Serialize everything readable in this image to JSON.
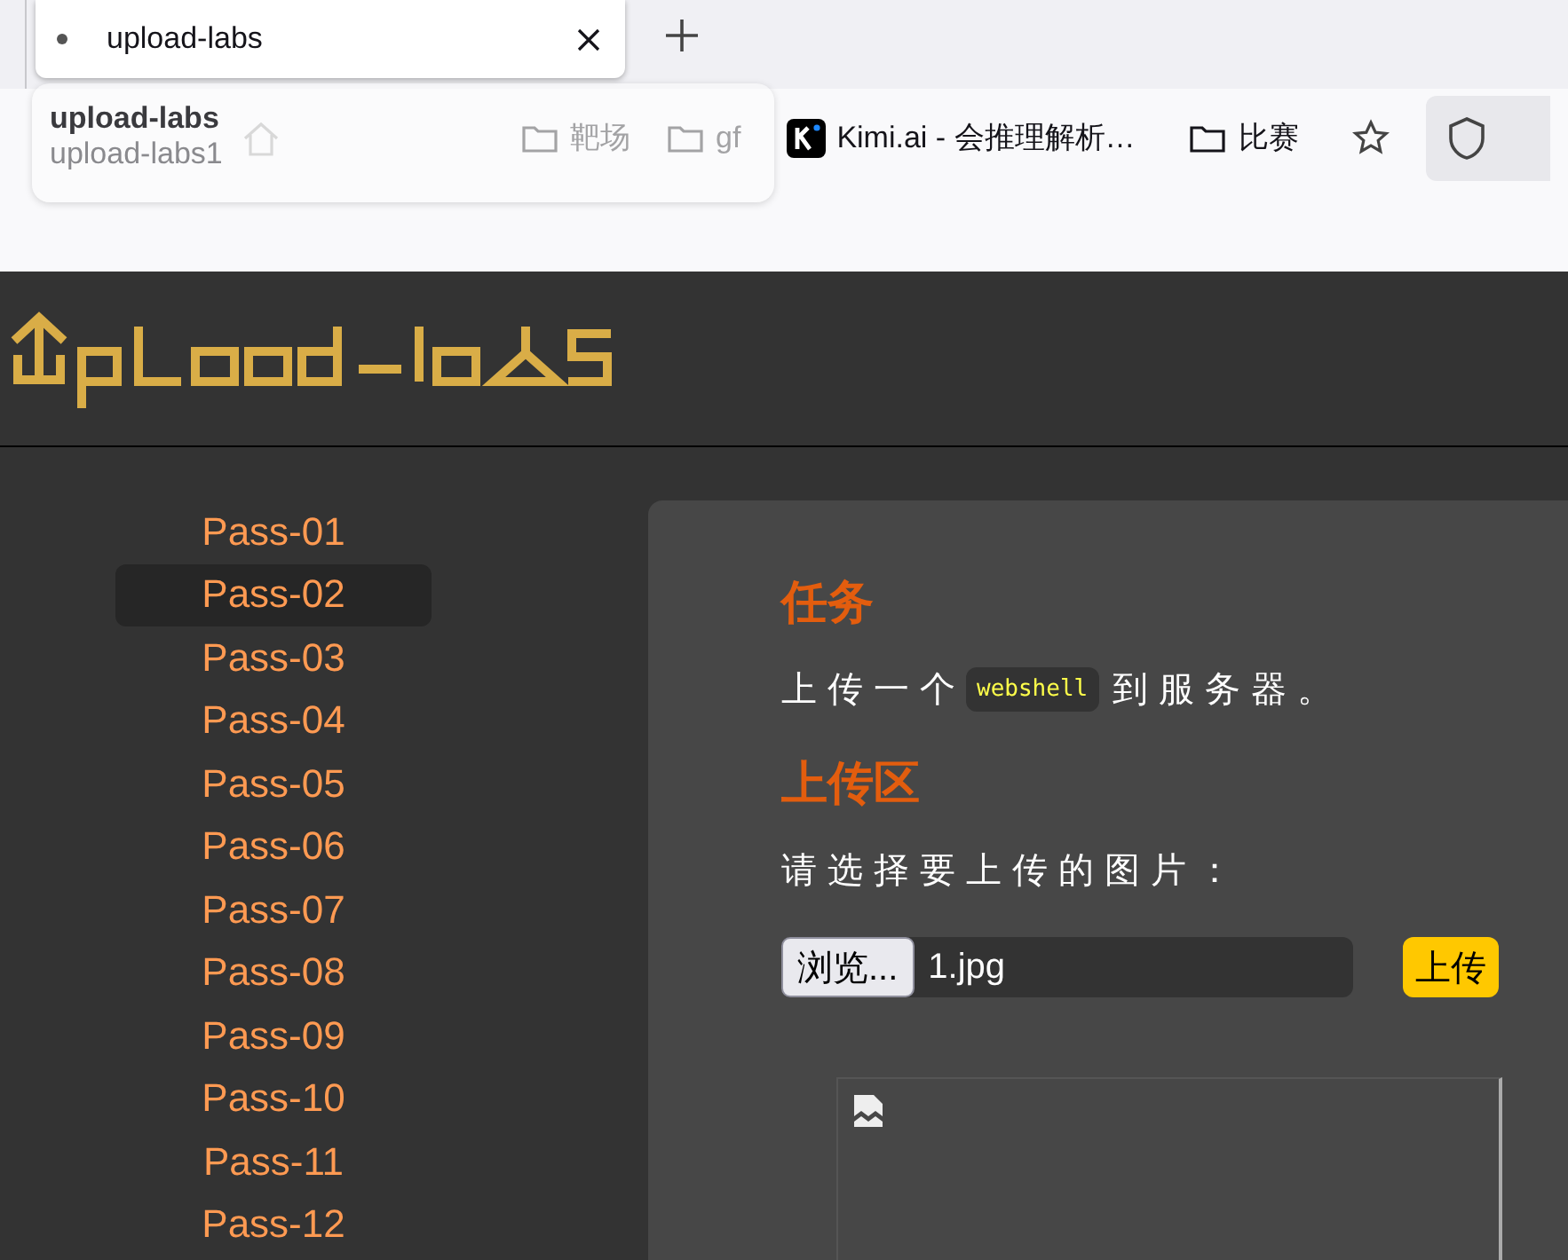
{
  "browser": {
    "tabs": [
      {
        "title": "upload-labs",
        "selected": true
      }
    ],
    "tooltip": {
      "title": "upload-labs",
      "subtitle": "upload-labs1"
    },
    "bookmarks": [
      {
        "kind": "folder",
        "label": "靶场"
      },
      {
        "kind": "folder",
        "label": "gf"
      },
      {
        "kind": "site",
        "label": "Kimi.ai - 会推理解析…"
      },
      {
        "kind": "folder",
        "label": "比赛"
      }
    ]
  },
  "page": {
    "nav": [
      {
        "label": "Pass-01",
        "selected": false
      },
      {
        "label": "Pass-02",
        "selected": true
      },
      {
        "label": "Pass-03",
        "selected": false
      },
      {
        "label": "Pass-04",
        "selected": false
      },
      {
        "label": "Pass-05",
        "selected": false
      },
      {
        "label": "Pass-06",
        "selected": false
      },
      {
        "label": "Pass-07",
        "selected": false
      },
      {
        "label": "Pass-08",
        "selected": false
      },
      {
        "label": "Pass-09",
        "selected": false
      },
      {
        "label": "Pass-10",
        "selected": false
      },
      {
        "label": "Pass-11",
        "selected": false
      },
      {
        "label": "Pass-12",
        "selected": false
      }
    ],
    "task": {
      "heading": "任务",
      "before": "上传一个",
      "code": "webshell",
      "after": "到服务器。"
    },
    "upload": {
      "heading": "上传区",
      "prompt": "请选择要上传的图片：",
      "browse_label": "浏览...",
      "file_name": "1.jpg",
      "submit_label": "上传"
    }
  }
}
